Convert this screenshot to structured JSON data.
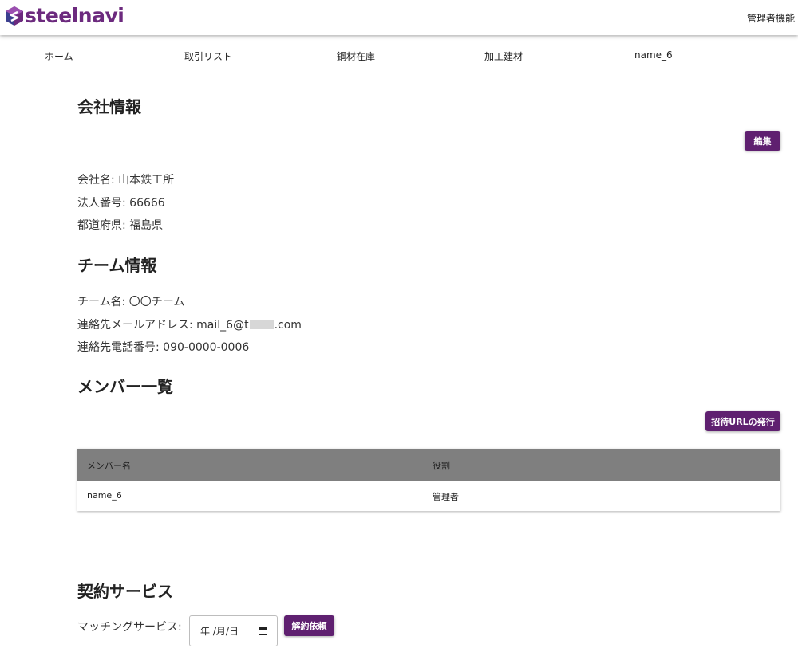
{
  "header": {
    "logo_text": "steelnavi",
    "admin_label": "管理者機能",
    "brand_color": "#6c2a7e"
  },
  "nav": {
    "items": [
      {
        "label": "ホーム"
      },
      {
        "label": "取引リスト"
      },
      {
        "label": "鋼材在庫"
      },
      {
        "label": "加工建材"
      },
      {
        "label": "name_6"
      }
    ]
  },
  "company": {
    "title": "会社情報",
    "edit_label": "編集",
    "fields": [
      {
        "label": "会社名: ",
        "value": "山本鉄工所"
      },
      {
        "label": "法人番号: ",
        "value": "66666"
      },
      {
        "label": "都道府県: ",
        "value": "福島県"
      }
    ]
  },
  "team": {
    "title": "チーム情報",
    "name_label": "チーム名: ",
    "name_value": "〇〇チーム",
    "email_label": "連絡先メールアドレス: ",
    "email_before": "mail_6@t",
    "email_after": ".com",
    "phone_label": "連絡先電話番号: ",
    "phone_value": "090-0000-0006"
  },
  "members": {
    "title": "メンバー一覧",
    "invite_label": "招待URLの発行",
    "columns": [
      "メンバー名",
      "役割"
    ],
    "rows": [
      [
        "name_6",
        "管理者"
      ]
    ]
  },
  "contract": {
    "title": "契約サービス",
    "matching_label": "マッチングサービス:",
    "date_placeholder": "年 /月/日",
    "cancel_label": "解約依頼"
  },
  "colors": {
    "button": "#5f2070",
    "table_header": "#7f7f7f"
  }
}
